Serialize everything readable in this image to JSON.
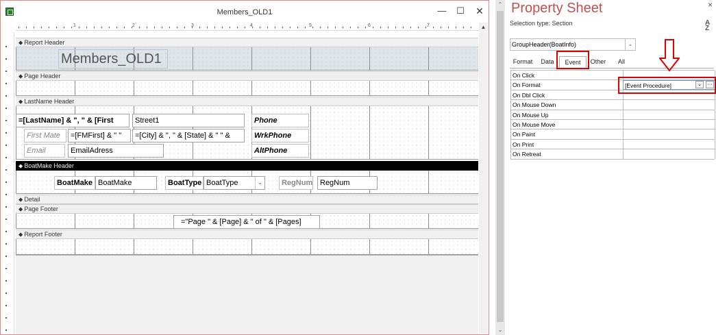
{
  "window": {
    "title": "Members_OLD1",
    "minimize_icon": "minimize-icon",
    "maximize_icon": "maximize-icon",
    "close_icon": "close-icon",
    "close_glyph": "✕",
    "maximize_glyph": "☐",
    "minimize_glyph": "—"
  },
  "ruler": {
    "numbers": [
      "1",
      "2",
      "3",
      "4",
      "5",
      "6",
      "7"
    ]
  },
  "sections": {
    "report_header": "Report Header",
    "page_header": "Page Header",
    "lastname_header": "LastName Header",
    "boatmake_header": "BoatMake Header",
    "detail": "Detail",
    "page_footer": "Page Footer",
    "report_footer": "Report Footer",
    "marker": "⬥"
  },
  "report_header": {
    "title": "Members_OLD1"
  },
  "lastname_header": {
    "name_expr": "=[LastName] & \",  \" & [First",
    "street": "Street1",
    "phone_label": "Phone",
    "first_mate_label": "First Mate",
    "fmfirst_expr": "=[FMFirst] & \"  \"",
    "city_expr": "=[City] & \",  \" & [State] & \" \" &",
    "wrkphone_label": "WrkPhone",
    "email_label": "Email",
    "email_field": "EmailAdress",
    "altphone_label": "AltPhone"
  },
  "boatmake_header": {
    "boatmake_label": "BoatMake",
    "boatmake_field": "BoatMake",
    "boattype_label": "BoatType",
    "boattype_field": "BoatType",
    "regnum_label": "RegNum",
    "regnum_field": "RegNum"
  },
  "page_footer": {
    "page_expr": "=\"Page \" & [Page] & \" of \" & [Pages]"
  },
  "property_sheet": {
    "title": "Property Sheet",
    "selection_type": "Selection type: Section",
    "sort_glyph": "A↓Z",
    "selected_object": "GroupHeader(BoatInfo)",
    "tabs": [
      "Format",
      "Data",
      "Event",
      "Other",
      "All"
    ],
    "active_tab": "Event",
    "properties": [
      {
        "name": "On Click",
        "value": ""
      },
      {
        "name": "On Format",
        "value": "[Event Procedure]"
      },
      {
        "name": "On Dbl Click",
        "value": ""
      },
      {
        "name": "On Mouse Down",
        "value": ""
      },
      {
        "name": "On Mouse Up",
        "value": ""
      },
      {
        "name": "On Mouse Move",
        "value": ""
      },
      {
        "name": "On Paint",
        "value": ""
      },
      {
        "name": "On Print",
        "value": ""
      },
      {
        "name": "On Retreat",
        "value": ""
      }
    ],
    "builder_glyph": "···",
    "close_glyph": "×"
  },
  "colors": {
    "accent": "#c0504d",
    "highlight": "#dd0000",
    "section_bar": "#f0f0f0",
    "boat_header_bar": "#000000"
  }
}
